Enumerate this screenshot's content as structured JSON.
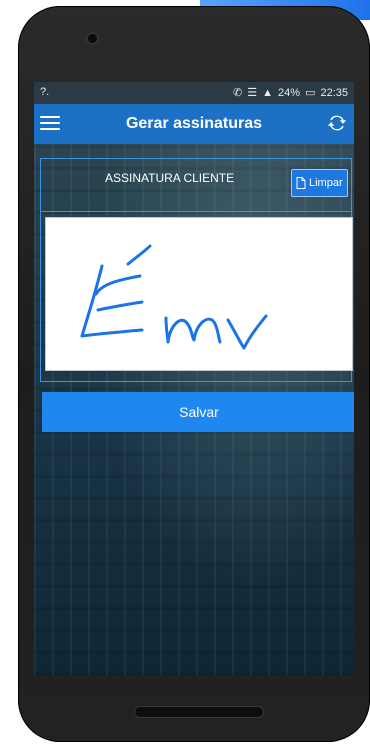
{
  "status_bar": {
    "carrier": "?.",
    "battery": "24%",
    "time": "22:35"
  },
  "app_bar": {
    "title": "Gerar assinaturas"
  },
  "signature": {
    "title": "ASSINATURA CLIENTE",
    "clear_label": "Limpar"
  },
  "actions": {
    "save_label": "Salvar"
  },
  "colors": {
    "appbar": "#1c71c7",
    "button": "#1e88f0"
  }
}
